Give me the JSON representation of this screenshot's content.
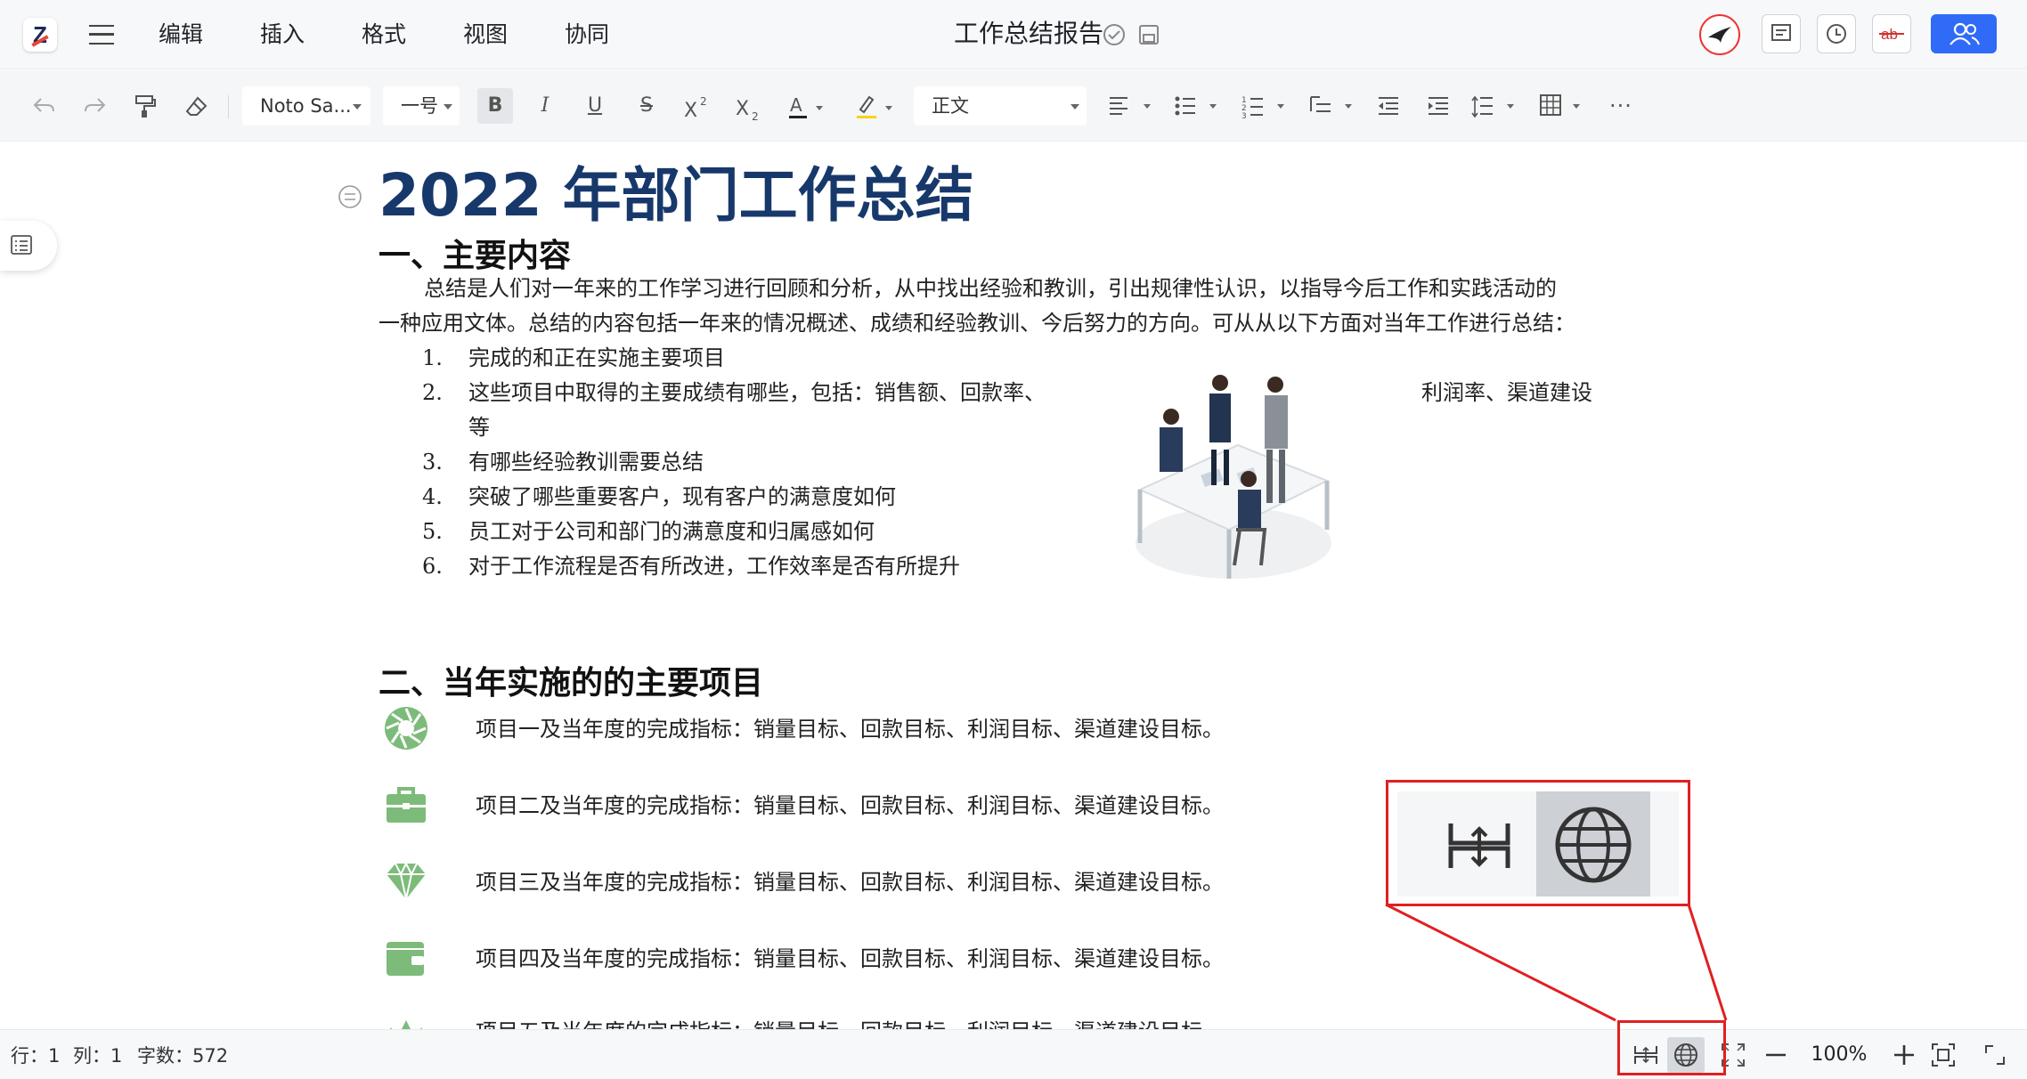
{
  "app": {
    "logo_letter": "Z"
  },
  "menu": {
    "items": [
      "编辑",
      "插入",
      "格式",
      "视图",
      "协同"
    ]
  },
  "document": {
    "title": "工作总结报告"
  },
  "toolbar": {
    "font_family": "Noto Sa...",
    "font_size": "一号",
    "bold": "B",
    "italic": "I",
    "underline": "U",
    "strike": "S",
    "paragraph_style": "正文",
    "more": "···",
    "highlight_color": "#f5d31b",
    "font_color": "#1f2329"
  },
  "content": {
    "title": "2022 年部门工作总结",
    "section1": {
      "heading": "一、主要内容",
      "paragraph_line1": "总结是人们对一年来的工作学习进行回顾和分析，从中找出经验和教训，引出规律性认识，以指导今后工作和实践活动的",
      "paragraph_line2": "一种应用文体。总结的内容包括一年来的情况概述、成绩和经验教训、今后努力的方向。可从从以下方面对当年工作进行总结：",
      "list": [
        {
          "num": "1.",
          "text": "完成的和正在实施主要项目"
        },
        {
          "num": "2.",
          "text": "这些项目中取得的主要成绩有哪些，包括：销售额、回款率、",
          "text_right": "利润率、渠道建设",
          "text_cont": "等"
        },
        {
          "num": "3.",
          "text": "有哪些经验教训需要总结"
        },
        {
          "num": "4.",
          "text": "突破了哪些重要客户，现有客户的满意度如何"
        },
        {
          "num": "5.",
          "text": "员工对于公司和部门的满意度和归属感如何"
        },
        {
          "num": "6.",
          "text": "对于工作流程是否有所改进，工作效率是否有所提升"
        }
      ]
    },
    "section2": {
      "heading": "二、当年实施的的主要项目",
      "projects": [
        {
          "icon": "aperture-icon",
          "text": "项目一及当年度的完成指标：销量目标、回款目标、利润目标、渠道建设目标。"
        },
        {
          "icon": "briefcase-icon",
          "text": "项目二及当年度的完成指标：销量目标、回款目标、利润目标、渠道建设目标。"
        },
        {
          "icon": "diamond-icon",
          "text": "项目三及当年度的完成指标：销量目标、回款目标、利润目标、渠道建设目标。"
        },
        {
          "icon": "wallet-icon",
          "text": "项目四及当年度的完成指标：销量目标、回款目标、利润目标、渠道建设目标。"
        },
        {
          "icon": "crown-icon",
          "text": "项目五及当年度的完成指标：销量目标、回款目标、利润目标、渠道建设目标。"
        }
      ]
    }
  },
  "status": {
    "row_label": "行：",
    "row": "1",
    "col_label": "列：",
    "col": "1",
    "words_label": "字数：",
    "words": "572",
    "zoom": "100%"
  },
  "colors": {
    "accent": "#2f6bf6",
    "title": "#17386b",
    "highlight_box": "#e02020",
    "icon_green": "#7dbb7a"
  }
}
